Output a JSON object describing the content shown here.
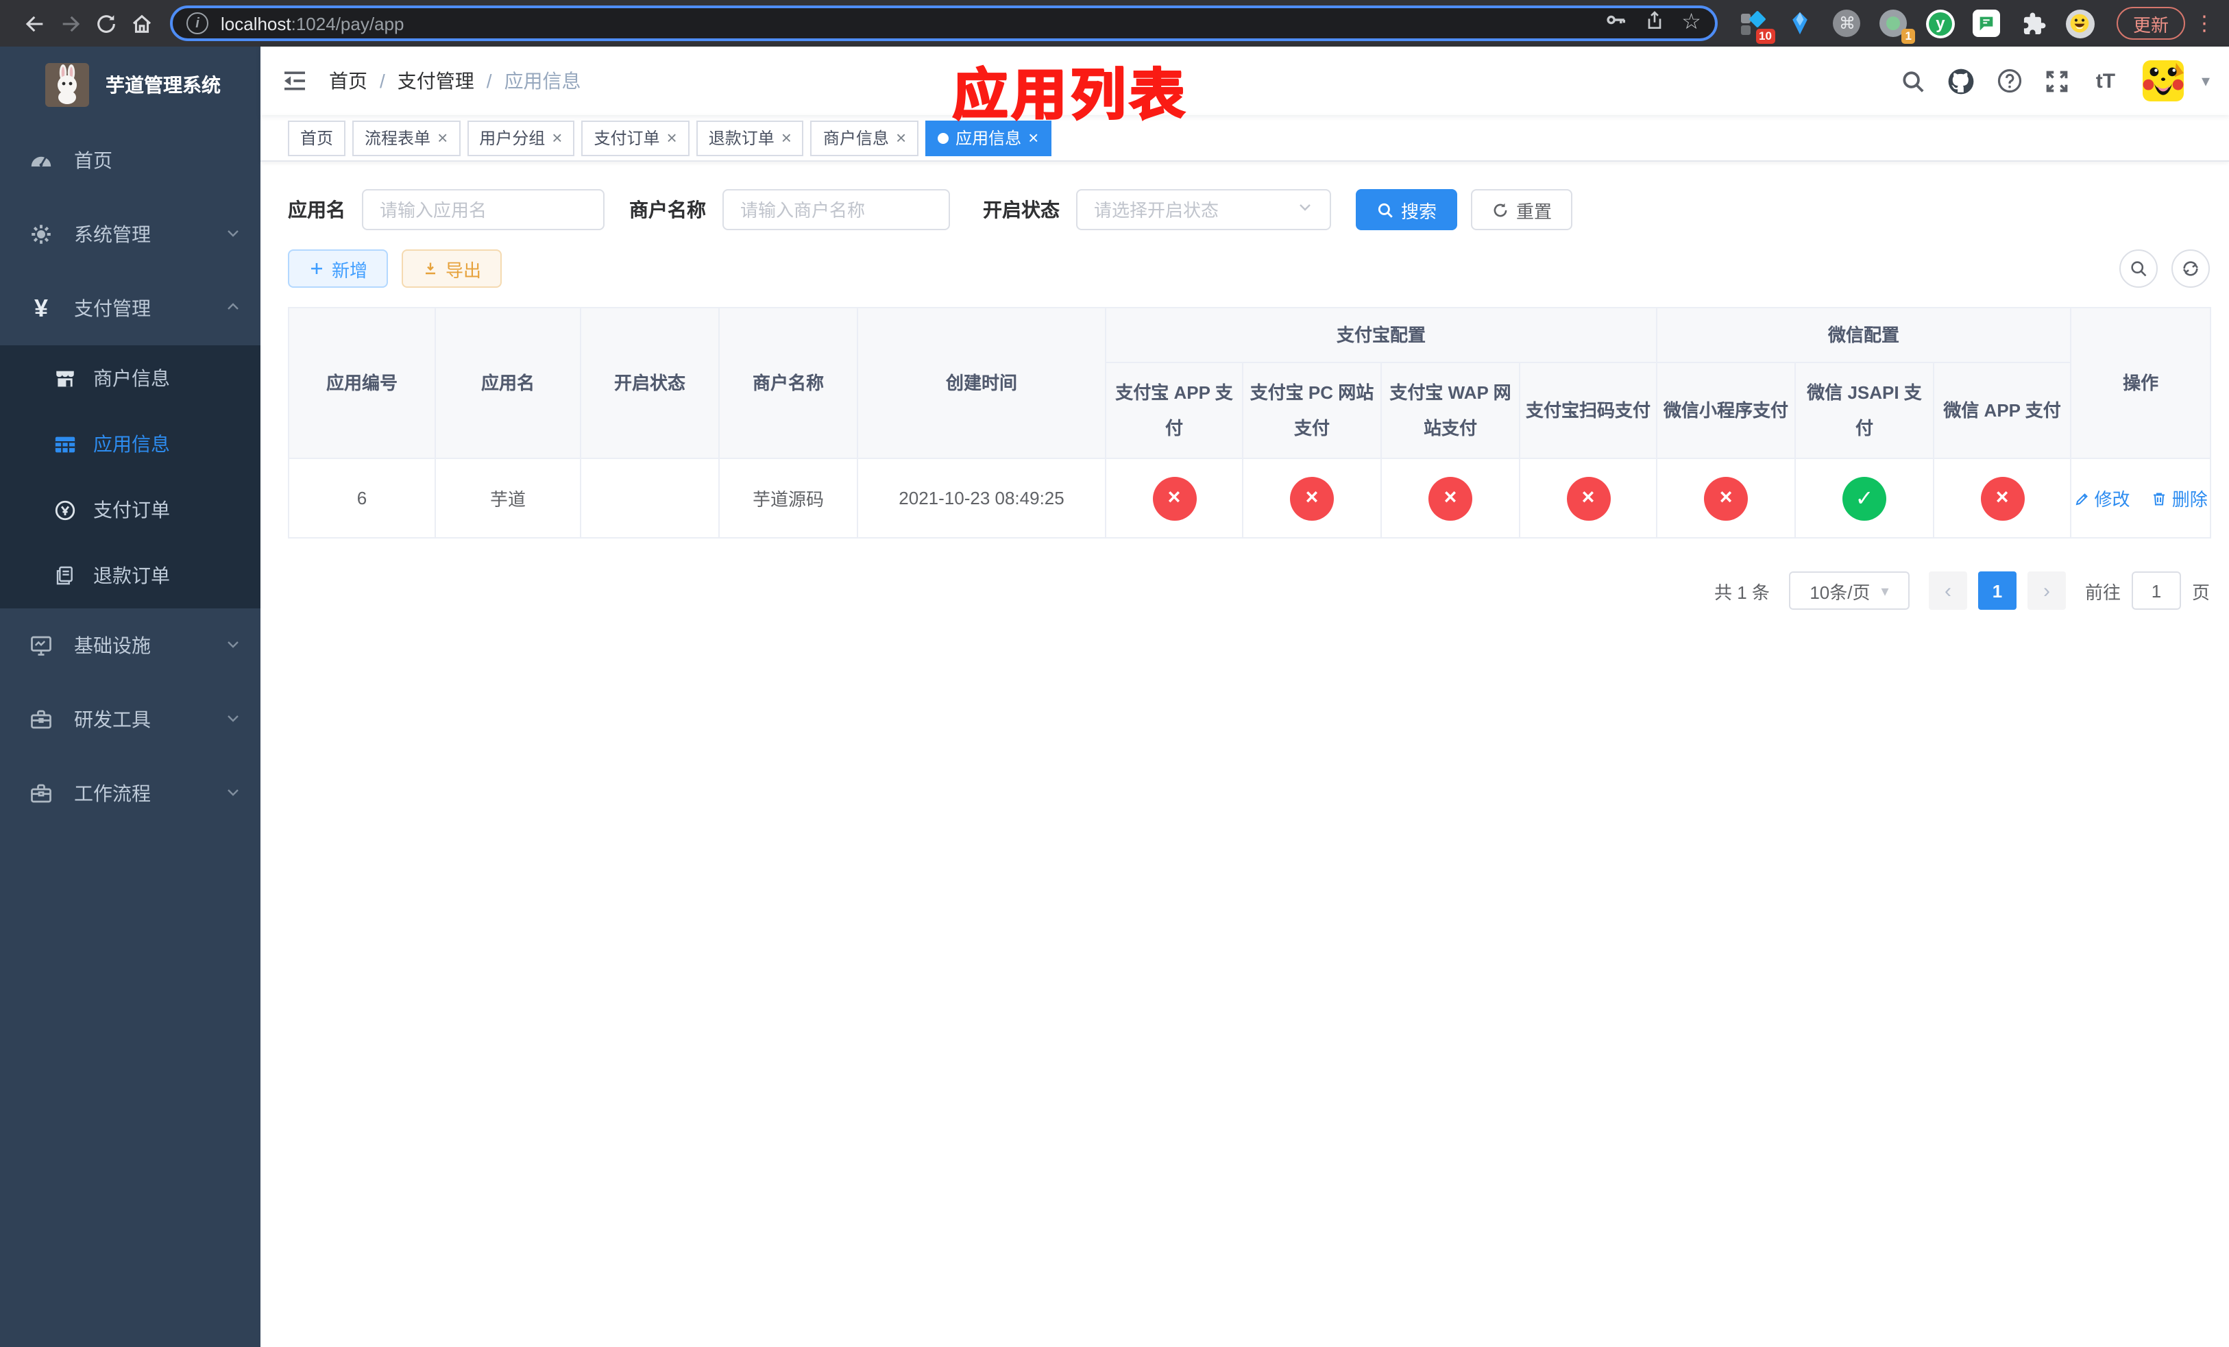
{
  "browser": {
    "url": {
      "host": "localhost",
      "rest": ":1024/pay/app"
    },
    "update_label": "更新",
    "extensions": {
      "badge_10": "10",
      "badge_1": "1",
      "command_glyph": "⌘",
      "y_glyph": "y"
    }
  },
  "icons": {
    "close": "×",
    "star": "☆",
    "kebab": "⋮",
    "caret_down": "▾",
    "select_chevron": "▾",
    "check": "✓",
    "cross": "×",
    "chevron_left": "‹",
    "chevron_right": "›",
    "info": "i",
    "question": "?",
    "font_size": "tT",
    "yen": "¥"
  },
  "sidebar": {
    "title": "芋道管理系统",
    "menu": [
      {
        "label": "首页",
        "icon": "dashboard-icon"
      },
      {
        "label": "系统管理",
        "icon": "gear-icon",
        "state": "collapsed"
      },
      {
        "label": "支付管理",
        "icon": "yen-icon",
        "state": "expanded"
      },
      {
        "label": "基础设施",
        "icon": "monitor-icon",
        "state": "collapsed"
      },
      {
        "label": "研发工具",
        "icon": "toolbox-icon",
        "state": "collapsed"
      },
      {
        "label": "工作流程",
        "icon": "briefcase-icon",
        "state": "collapsed"
      }
    ],
    "pay_submenu": [
      {
        "label": "商户信息",
        "icon": "shop-icon",
        "active": false
      },
      {
        "label": "应用信息",
        "icon": "grid-icon",
        "active": true
      },
      {
        "label": "支付订单",
        "icon": "coin-icon",
        "active": false
      },
      {
        "label": "退款订单",
        "icon": "document-icon",
        "active": false
      }
    ]
  },
  "header": {
    "breadcrumb": [
      "首页",
      "支付管理",
      "应用信息"
    ],
    "separator": "/",
    "annotation": "应用列表"
  },
  "tabs": [
    {
      "label": "首页",
      "closable": false,
      "active": false
    },
    {
      "label": "流程表单",
      "closable": true,
      "active": false
    },
    {
      "label": "用户分组",
      "closable": true,
      "active": false
    },
    {
      "label": "支付订单",
      "closable": true,
      "active": false
    },
    {
      "label": "退款订单",
      "closable": true,
      "active": false
    },
    {
      "label": "商户信息",
      "closable": true,
      "active": false
    },
    {
      "label": "应用信息",
      "closable": true,
      "active": true
    }
  ],
  "filters": {
    "app_name": {
      "label": "应用名",
      "placeholder": "请输入应用名",
      "value": ""
    },
    "merchant_name": {
      "label": "商户名称",
      "placeholder": "请输入商户名称",
      "value": ""
    },
    "status": {
      "label": "开启状态",
      "placeholder": "请选择开启状态",
      "value": ""
    },
    "search_label": "搜索",
    "reset_label": "重置"
  },
  "toolbar": {
    "add_label": "新增",
    "export_label": "导出"
  },
  "table": {
    "groups": {
      "alipay": "支付宝配置",
      "wechat": "微信配置"
    },
    "columns": {
      "app_id": "应用编号",
      "app_name": "应用名",
      "status": "开启状态",
      "merchant": "商户名称",
      "create_time": "创建时间",
      "alipay_app": "支付宝 APP 支付",
      "alipay_pc": "支付宝 PC 网站支付",
      "alipay_wap": "支付宝 WAP 网站支付",
      "alipay_qr": "支付宝扫码支付",
      "wx_lite": "微信小程序支付",
      "wx_jsapi": "微信 JSAPI 支付",
      "wx_app": "微信 APP 支付",
      "ops": "操作"
    },
    "rows": [
      {
        "app_id": "6",
        "app_name": "芋道",
        "enabled": true,
        "merchant": "芋道源码",
        "create_time": "2021-10-23 08:49:25",
        "pay_status": {
          "alipay_app": "disabled",
          "alipay_pc": "disabled",
          "alipay_wap": "disabled",
          "alipay_qr": "disabled",
          "wx_lite": "disabled",
          "wx_jsapi": "enabled",
          "wx_app": "disabled"
        },
        "edit_label": "修改",
        "delete_label": "删除"
      }
    ]
  },
  "pagination": {
    "total": "共 1 条",
    "page_size": "10条/页",
    "current_page": "1",
    "goto_label": "前往",
    "goto_value": "1",
    "page_suffix": "页"
  },
  "colors": {
    "primary": "#2d8cf0",
    "success": "#0fc160",
    "danger": "#f5494d",
    "warning": "#e6a23c",
    "annotation_red": "#fa1b14",
    "sidebar_bg": "#304156",
    "submenu_bg": "#1f2d3d"
  }
}
